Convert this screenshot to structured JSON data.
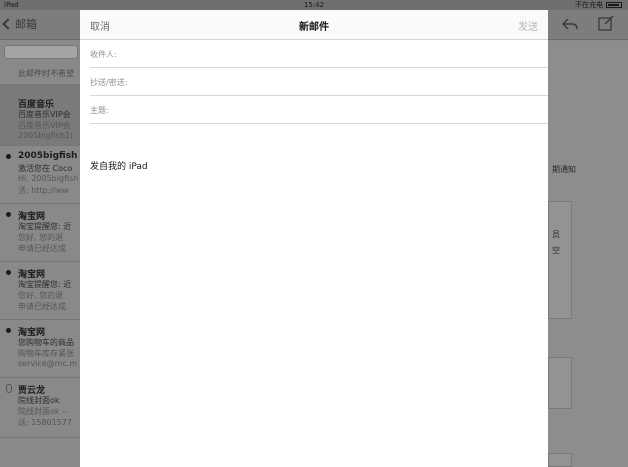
{
  "status_bar": {
    "left": "iPad",
    "time": "15:42",
    "right": "不在充电"
  },
  "background_app": {
    "back_label": "邮箱",
    "notice": "此邮件时不希望",
    "mails": [
      {
        "from": "百度音乐",
        "subject": "百度音乐VIP会",
        "preview1": "百度音乐VIP会",
        "preview2": "2005bigfish1(",
        "unread": false
      },
      {
        "from": "2005bigfish",
        "subject": "激活您在 Coco",
        "preview1": "Hi, 2005bigfish",
        "preview2": "活:  http://ww",
        "unread": true
      },
      {
        "from": "淘宝网",
        "subject": "淘宝提醒您: 近",
        "preview1": "您好,  您的退",
        "preview2": "申请已经达成",
        "unread": true
      },
      {
        "from": "淘宝网",
        "subject": "淘宝提醒您: 近",
        "preview1": "您好,  您的退",
        "preview2": "申请已经达成",
        "unread": true
      },
      {
        "from": "淘宝网",
        "subject": "您购物车的商品",
        "preview1": "购物车库存紧张",
        "preview2": "service@mc.m",
        "unread": true
      },
      {
        "from": "贾云龙",
        "subject": "院线封面ok",
        "preview1": "院线封面ok --",
        "preview2": "话:  15801577",
        "unread": false
      }
    ],
    "detail": {
      "line1": "期通知",
      "line2": "员",
      "line3": "空"
    }
  },
  "compose": {
    "cancel_label": "取消",
    "title": "新邮件",
    "send_label": "发送",
    "to_label": "收件人:",
    "cc_label": "抄送/密送:",
    "subject_label": "主题:",
    "to_value": "",
    "cc_value": "",
    "subject_value": "",
    "signature": "发自我的 iPad"
  },
  "colors": {
    "dim_background": "#8a8a8a",
    "modal_background": "#ffffff",
    "send_disabled": "#b6b6b6"
  }
}
